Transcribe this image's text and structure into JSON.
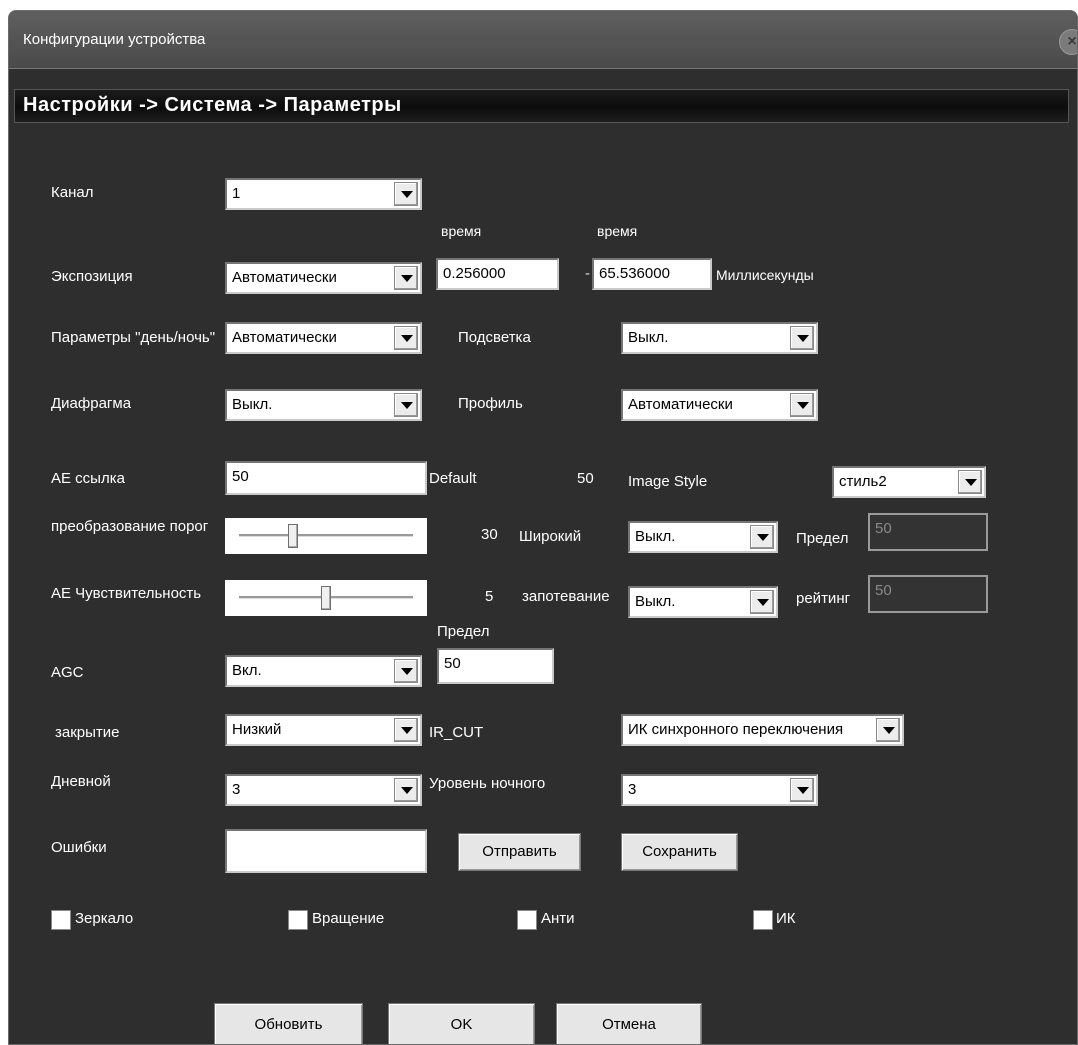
{
  "window": {
    "title": "Конфигурации устройства",
    "close_glyph": "×"
  },
  "section": {
    "breadcrumb": "Настройки -> Система -> Параметры"
  },
  "channel": {
    "label": "Канал",
    "value": "1"
  },
  "exposure": {
    "label": "Экспозиция",
    "mode": "Автоматически",
    "time_label_min": "время",
    "time_label_max": "время",
    "min_value": "0.256000",
    "max_value": "65.536000",
    "dash": "-",
    "unit": "Миллисекунды"
  },
  "day_night": {
    "label": "Параметры \"день/ночь\"",
    "value": "Автоматически"
  },
  "backlight": {
    "label": "Подсветка",
    "value": "Выкл."
  },
  "iris": {
    "label": "Диафрагма",
    "value": "Выкл."
  },
  "profile": {
    "label": "Профиль",
    "value": "Автоматически"
  },
  "ae_ref": {
    "label": "AE ссылка",
    "value": "50",
    "default_label": "Default",
    "default_value": "50"
  },
  "image_style": {
    "label": "Image Style",
    "value": "стиль2"
  },
  "threshold": {
    "label": "преобразование порог",
    "value": "30",
    "level": 0.3
  },
  "wide": {
    "label": "Широкий",
    "value": "Выкл.",
    "limit_label": "Предел",
    "limit_value": "50"
  },
  "ae_sens": {
    "label": "AE Чувствительность",
    "value": "5",
    "level": 0.5
  },
  "defog": {
    "label": "запотевание",
    "value": "Выкл.",
    "rating_label": "рейтинг",
    "rating_value": "50"
  },
  "agc": {
    "label": "AGC",
    "value": "Вкл.",
    "limit_label": "Предел",
    "limit_value": "50"
  },
  "shutter": {
    "label": "закрытие",
    "value": "Низкий"
  },
  "ircut": {
    "label": "IR_CUT",
    "value": "ИК синхронного переключения"
  },
  "day_level": {
    "label": "Дневной",
    "value": "3"
  },
  "night_level": {
    "label": "Уровень ночного",
    "value": "3"
  },
  "errors": {
    "label": "Ошибки",
    "value": "",
    "send": "Отправить",
    "save": "Сохранить"
  },
  "checkboxes": {
    "mirror": "Зеркало",
    "rotate": "Вращение",
    "anti": "Анти",
    "ir": "ИК"
  },
  "footer": {
    "refresh": "Обновить",
    "ok": "OK",
    "cancel": "Отмена"
  }
}
